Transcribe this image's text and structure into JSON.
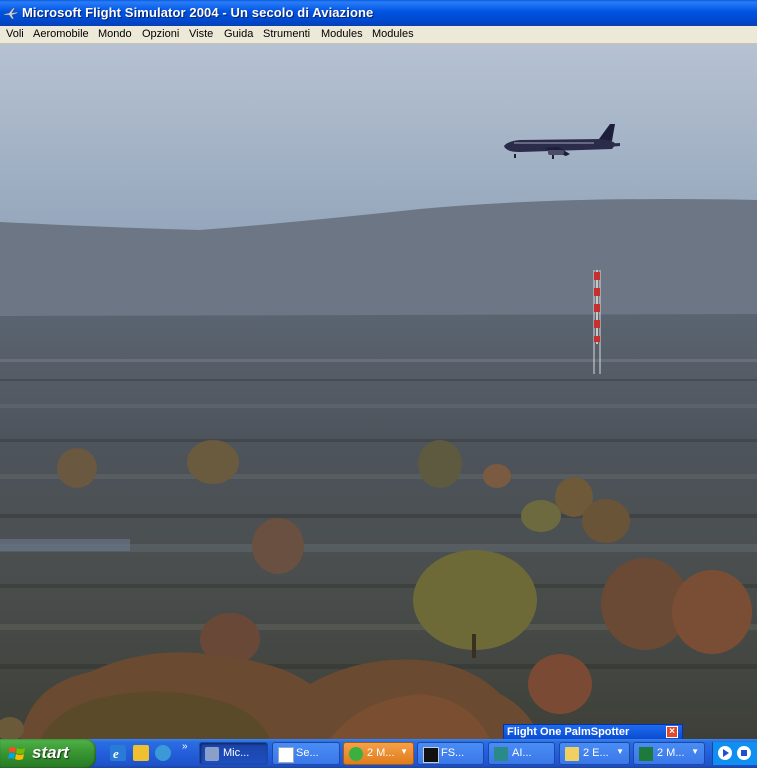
{
  "window": {
    "title": "Microsoft Flight Simulator 2004 - Un secolo di Aviazione",
    "icon": "plane-icon"
  },
  "menu": {
    "items": [
      "Voli",
      "Aeromobile",
      "Mondo",
      "Opzioni",
      "Viste",
      "Guida",
      "Strumenti",
      "Modules",
      "Modules"
    ]
  },
  "scene": {
    "sky_top": "#b7c3d3",
    "sky_horizon": "#8da0b8",
    "ground_color": "#4f5660",
    "aircraft": "airliner",
    "tower": "radio-mast"
  },
  "palmspotter": {
    "title": "Flight One PalmSpotter",
    "close_icon": "close-icon"
  },
  "taskbar": {
    "start_label": "start",
    "quick_launch": [
      "ie-icon",
      "media-icon",
      "browser-icon"
    ],
    "more_label": "»",
    "tasks": [
      {
        "label": "Mic...",
        "icon": "plane-icon"
      },
      {
        "label": "Se...",
        "icon": "document-icon"
      },
      {
        "label": "2 M...",
        "icon": "messenger-icon"
      },
      {
        "label": "FS...",
        "icon": "window-icon"
      },
      {
        "label": "AI...",
        "icon": "app-icon"
      },
      {
        "label": "2 E...",
        "icon": "folder-icon"
      },
      {
        "label": "2 M...",
        "icon": "excel-icon"
      }
    ]
  },
  "colors": {
    "titlebar": "#0054e3",
    "taskbar": "#245edb",
    "start": "#3c9a36"
  }
}
